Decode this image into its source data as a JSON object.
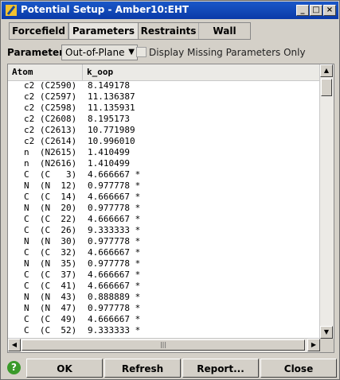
{
  "window": {
    "title": "Potential Setup - Amber10:EHT"
  },
  "tabs": [
    "Forcefield",
    "Parameters",
    "Restraints",
    "Wall"
  ],
  "parameter": {
    "label": "Parameter:",
    "value": "Out-of-Plane",
    "checkbox_label": "Display Missing Parameters Only"
  },
  "table": {
    "columns": [
      "Atom",
      "k_oop"
    ],
    "rows": [
      {
        "atom": "c2 (C2590)",
        "k": "8.149178"
      },
      {
        "atom": "c2 (C2597)",
        "k": "11.136387"
      },
      {
        "atom": "c2 (C2598)",
        "k": "11.135931"
      },
      {
        "atom": "c2 (C2608)",
        "k": "8.195173"
      },
      {
        "atom": "c2 (C2613)",
        "k": "10.771989"
      },
      {
        "atom": "c2 (C2614)",
        "k": "10.996010"
      },
      {
        "atom": "n  (N2615)",
        "k": "1.410499"
      },
      {
        "atom": "n  (N2616)",
        "k": "1.410499"
      },
      {
        "atom": "C  (C   3)",
        "k": "4.666667 *"
      },
      {
        "atom": "N  (N  12)",
        "k": "0.977778 *"
      },
      {
        "atom": "C  (C  14)",
        "k": "4.666667 *"
      },
      {
        "atom": "N  (N  20)",
        "k": "0.977778 *"
      },
      {
        "atom": "C  (C  22)",
        "k": "4.666667 *"
      },
      {
        "atom": "C  (C  26)",
        "k": "9.333333 *"
      },
      {
        "atom": "N  (N  30)",
        "k": "0.977778 *"
      },
      {
        "atom": "C  (C  32)",
        "k": "4.666667 *"
      },
      {
        "atom": "N  (N  35)",
        "k": "0.977778 *"
      },
      {
        "atom": "C  (C  37)",
        "k": "4.666667 *"
      },
      {
        "atom": "C  (C  41)",
        "k": "4.666667 *"
      },
      {
        "atom": "N  (N  43)",
        "k": "0.888889 *"
      },
      {
        "atom": "N  (N  47)",
        "k": "0.977778 *"
      },
      {
        "atom": "C  (C  49)",
        "k": "4.666667 *"
      },
      {
        "atom": "C  (C  52)",
        "k": "9.333333 *"
      }
    ]
  },
  "buttons": {
    "help": "?",
    "ok": "OK",
    "refresh": "Refresh",
    "report": "Report...",
    "close": "Close"
  },
  "colors": {
    "titlebar": "#0a3aa8",
    "help": "#3a9a2a"
  }
}
